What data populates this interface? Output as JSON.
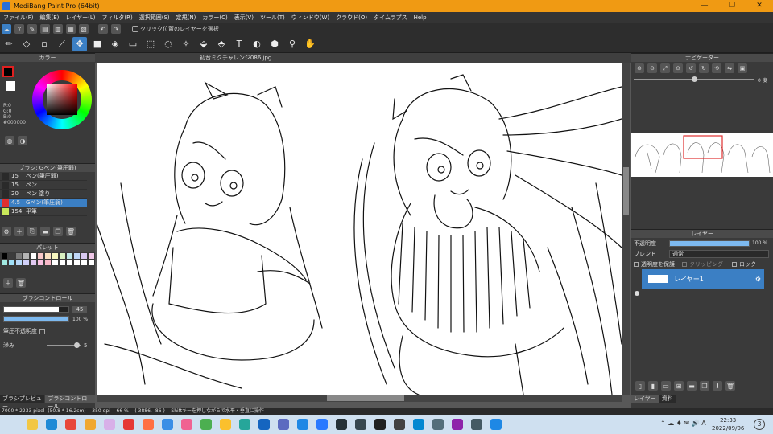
{
  "window": {
    "title": "MediBang Paint Pro (64bit)",
    "controls": {
      "minimize": "—",
      "maximize": "❐",
      "close": "✕"
    }
  },
  "menu": [
    "ファイル(F)",
    "編集(E)",
    "レイヤー(L)",
    "フィルタ(R)",
    "選択範囲(S)",
    "定規(N)",
    "カラー(C)",
    "表示(V)",
    "ツール(T)",
    "ウィンドウ(W)",
    "クラウド(O)",
    "タイムラプス",
    "Help"
  ],
  "toolbar1": {
    "select_on_click_label": "クリック位置のレイヤーを選択"
  },
  "document": {
    "tab_title": "初音ミクチャレンジ086.jpg"
  },
  "color_panel": {
    "header": "カラー",
    "readout": {
      "r": "R:0",
      "g": "G:0",
      "b": "B:0",
      "hex": "#000000"
    },
    "main_color": "#000000"
  },
  "brush_panel": {
    "header": "ブラシ: Gペン(筆圧弱)",
    "items": [
      {
        "size": "15",
        "name": "ペン(筆圧弱)",
        "swatch": "#2a2a2a"
      },
      {
        "size": "15",
        "name": "ペン",
        "swatch": "#2a2a2a"
      },
      {
        "size": "20",
        "name": "ペン 塗り",
        "swatch": "#2a2a2a"
      },
      {
        "size": "4.5",
        "name": "Gペン(筆圧弱)",
        "swatch": "#e03030",
        "selected": true
      },
      {
        "size": "154",
        "name": "平筆",
        "swatch": "#c8e85a"
      }
    ]
  },
  "palette_panel": {
    "header": "パレット",
    "colors": [
      "#000000",
      "#3c3c3c",
      "#7a7a7a",
      "#b4b4b4",
      "#ffffff",
      "#f8c8c8",
      "#f8e0c0",
      "#f8f8c0",
      "#d8f0c0",
      "#c0e8e8",
      "#c0d8f8",
      "#d8c8f0",
      "#f0c8e8",
      "#a0e8e0",
      "#a0e0f8",
      "#b8d8f8",
      "#d0d0f8",
      "#e0c8f0",
      "#f8c0e0",
      "#f8b8c8",
      "#ffffff",
      "#ffffff",
      "#ffffff",
      "#ffffff",
      "#ffffff",
      "#ffffff"
    ]
  },
  "brush_control": {
    "header": "ブラシコントロール",
    "size_value": "45",
    "size_fraction": 0.85,
    "opacity_value": "100 %",
    "opacity_fraction": 1.0,
    "pressure_opacity_label": "筆圧不透明度",
    "smoothing_label": "滲み",
    "smoothing_value": "5"
  },
  "left_tabs": [
    "ブラシプレビュー",
    "ブラシコントロール"
  ],
  "navigator": {
    "header": "ナビゲーター",
    "angle_value": "0 度"
  },
  "layer_panel": {
    "header": "レイヤー",
    "opacity_label": "不透明度",
    "opacity_value": "100 %",
    "blend_label": "ブレンド",
    "blend_value": "通常",
    "protect_label": "透明度を保護",
    "clipping_label": "クリッピング",
    "lock_label": "ロック",
    "layer_name": "レイヤー1"
  },
  "right_tabs": [
    "レイヤー",
    "資料"
  ],
  "status": {
    "text": "7000 * 2233 pixel  (50.8 * 16.2cm)    350 dpi    66 %    ( 3886, -86 )    Shiftキーを押しながらで水平・垂直に操作"
  },
  "taskbar": {
    "time": "22:33",
    "date": "2022/09/06",
    "icons": [
      "#f2c744",
      "#1e8ad6",
      "#e8483a",
      "#f0a830",
      "#d8b0e8",
      "#e53935",
      "#ff7043",
      "#3a8ee6",
      "#f06292",
      "#4caf50",
      "#fbc02d",
      "#26a69a",
      "#1565c0",
      "#5c6bc0",
      "#1e88e5",
      "#2979ff",
      "#263238",
      "#37474f",
      "#212121",
      "#424242",
      "#0288d1",
      "#546e7a",
      "#8e24aa",
      "#455a64",
      "#1e88e5"
    ]
  }
}
